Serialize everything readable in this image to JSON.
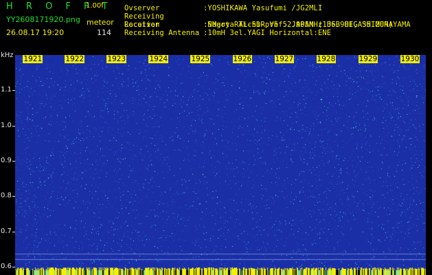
{
  "header": {
    "title": "H R O F F T",
    "version": "1.00f",
    "filename": "YY2608171920.png",
    "mode_label": "meteor",
    "timestamp": "26.08.17 19:20",
    "count": "114"
  },
  "info": [
    {
      "key": "Ovserver",
      "value": ":YOSHIKAWA Yasufumi /JG2MLI"
    },
    {
      "key": "Receiving Location",
      "value": ":Nagoya Aichi-pref. JAPAN (136.90E, 35.20N)"
    },
    {
      "key": "Receiver",
      "value": ":SMart RTL-SDR V5 52.905MHz USB HIGASHIMURAYAMA"
    },
    {
      "key": "Receiving Antenna",
      "value": ":10mH 3el.YAGI Horizontal:ENE"
    }
  ],
  "spectrogram": {
    "unit": "kHz",
    "hour_labels": [
      "1921",
      "1922",
      "1923",
      "1924",
      "1925",
      "1926",
      "1927",
      "1928",
      "1929",
      "1930"
    ],
    "freq_labels": [
      "1.1",
      "1.0",
      "0.9",
      "0.8",
      "0.7",
      "0.6"
    ],
    "freq_range_khz": [
      0.59,
      1.2
    ],
    "minutes_range": [
      1920.6,
      1930.4
    ],
    "colors": {
      "background": "#1a2fa6",
      "noise_low": "#2a52d8",
      "noise_mid": "#3a8cf0",
      "noise_high": "#55d8e8",
      "marker": "#f4f000"
    }
  }
}
